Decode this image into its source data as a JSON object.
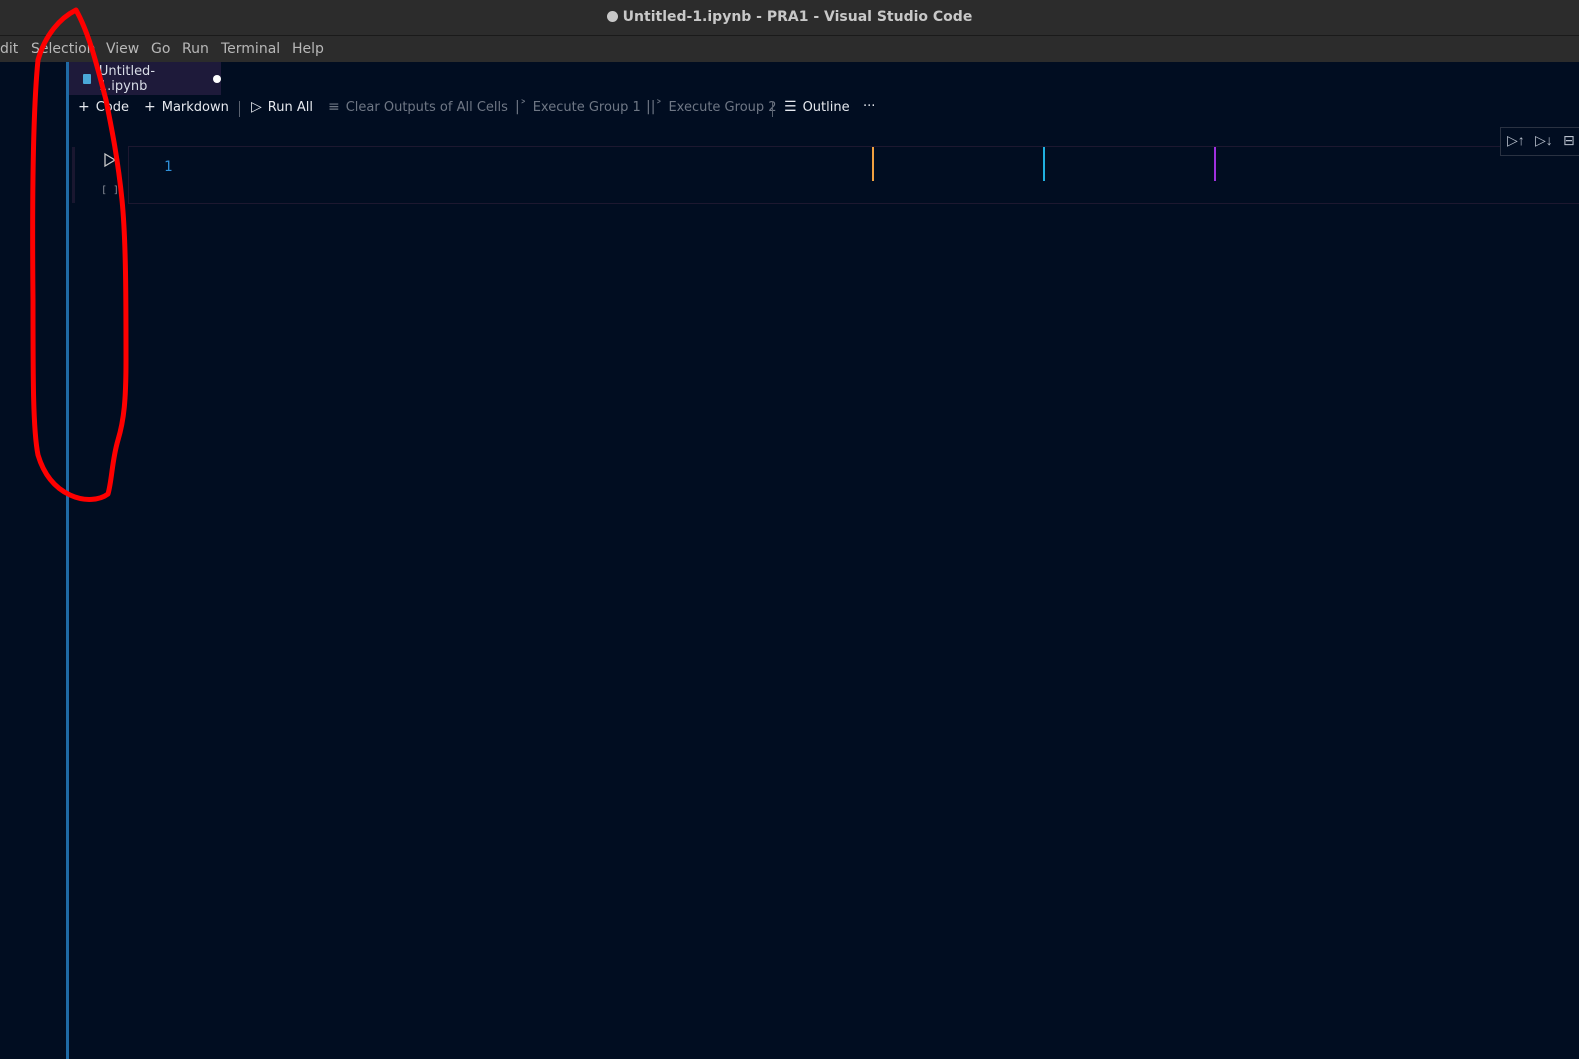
{
  "window": {
    "title": "Untitled-1.ipynb - PRA1 - Visual Studio Code",
    "dirty_indicator": "●"
  },
  "menu": [
    "dit",
    "Selection",
    "View",
    "Go",
    "Run",
    "Terminal",
    "Help"
  ],
  "tab": {
    "label": "Untitled-1.ipynb",
    "icon": "notebook-icon",
    "modified": true
  },
  "toolbar": {
    "code_label": "Code",
    "markdown_label": "Markdown",
    "run_all_label": "Run All",
    "clear_outputs_label": "Clear Outputs of All Cells",
    "execute_group1_label": "Execute Group 1",
    "execute_group2_label": "Execute Group 2",
    "outline_label": "Outline",
    "more_label": "···"
  },
  "cell": {
    "execution_count": "[ ]",
    "line_number": "1",
    "ruler_colors": [
      "#f0a040",
      "#20b0e0",
      "#a030e0"
    ]
  },
  "colors": {
    "editor_bg": "#010d21",
    "titlebar_bg": "#2c2c2c",
    "accent": "#1f6aa5",
    "annotation": "#ff0000"
  }
}
